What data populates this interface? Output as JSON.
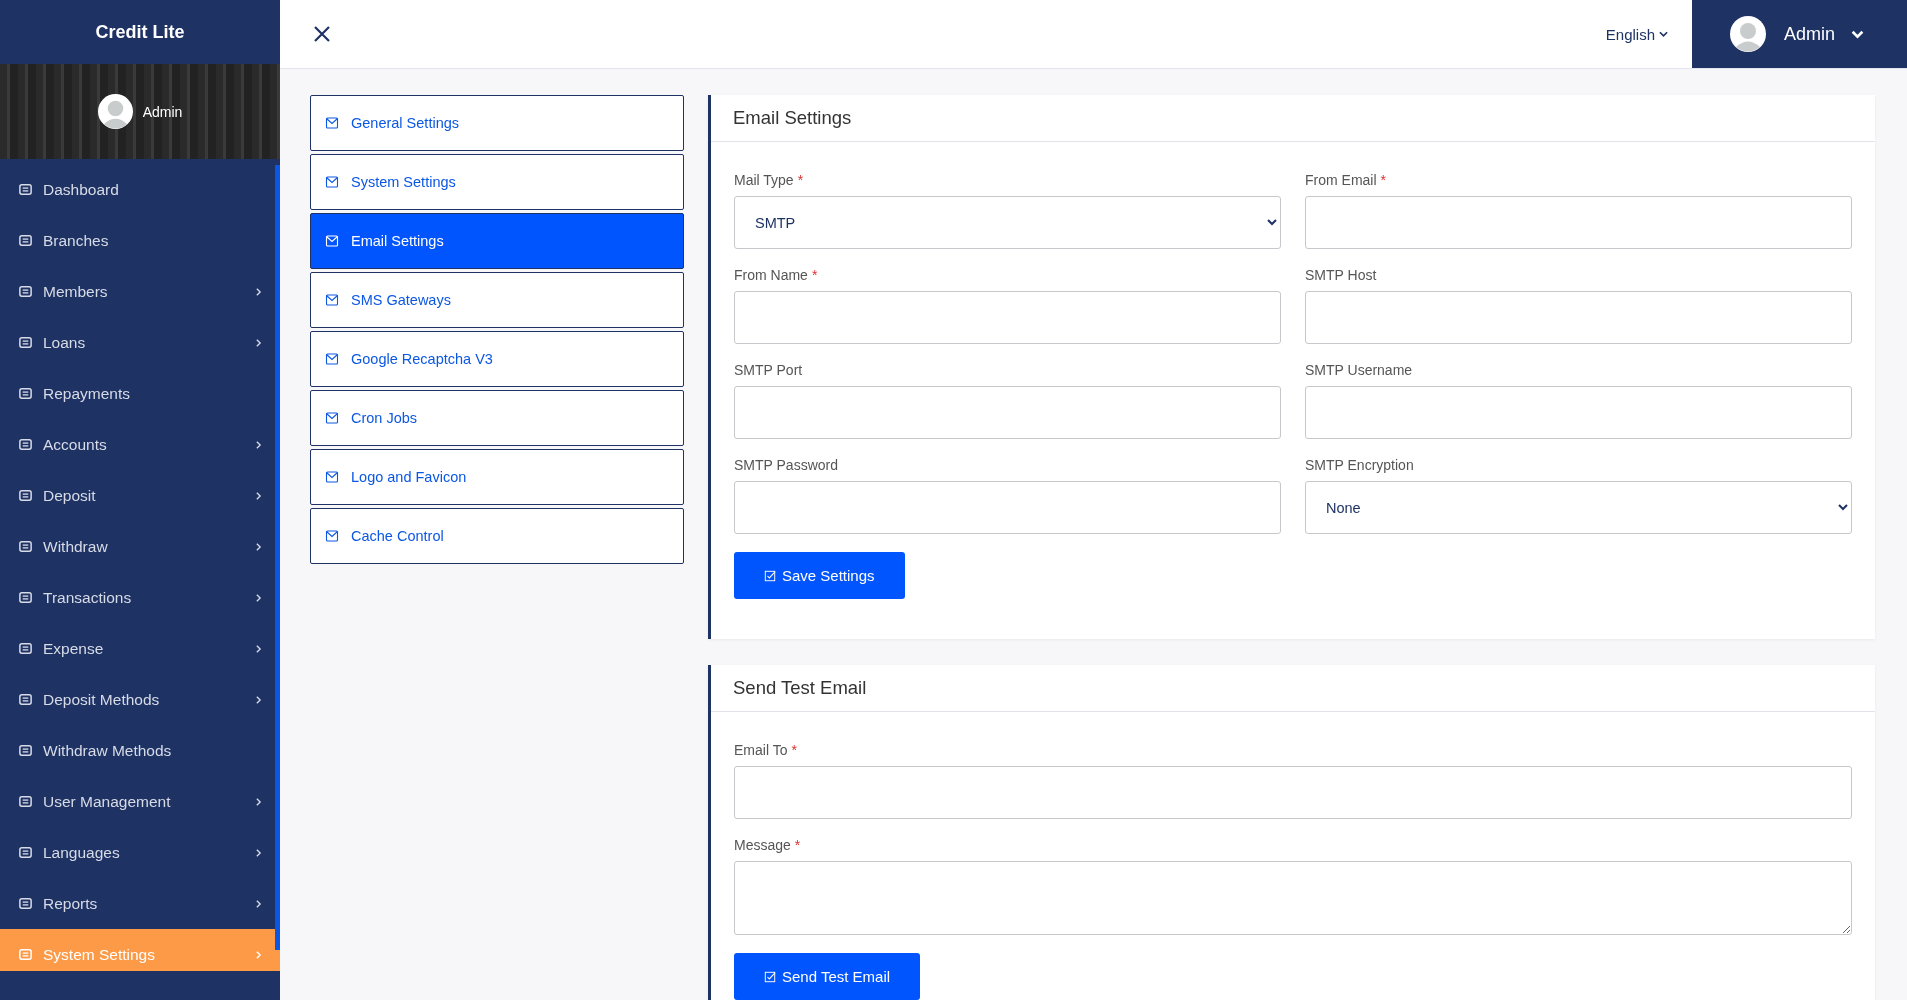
{
  "sidebar": {
    "brand": "Credit Lite",
    "user": "Admin",
    "items": [
      {
        "label": "Dashboard",
        "has_submenu": false,
        "selected": false
      },
      {
        "label": "Branches",
        "has_submenu": false,
        "selected": false
      },
      {
        "label": "Members",
        "has_submenu": true,
        "selected": false
      },
      {
        "label": "Loans",
        "has_submenu": true,
        "selected": false
      },
      {
        "label": "Repayments",
        "has_submenu": false,
        "selected": false
      },
      {
        "label": "Accounts",
        "has_submenu": true,
        "selected": false
      },
      {
        "label": "Deposit",
        "has_submenu": true,
        "selected": false
      },
      {
        "label": "Withdraw",
        "has_submenu": true,
        "selected": false
      },
      {
        "label": "Transactions",
        "has_submenu": true,
        "selected": false
      },
      {
        "label": "Expense",
        "has_submenu": true,
        "selected": false
      },
      {
        "label": "Deposit Methods",
        "has_submenu": true,
        "selected": false
      },
      {
        "label": "Withdraw Methods",
        "has_submenu": false,
        "selected": false
      },
      {
        "label": "User Management",
        "has_submenu": true,
        "selected": false
      },
      {
        "label": "Languages",
        "has_submenu": true,
        "selected": false
      },
      {
        "label": "Reports",
        "has_submenu": true,
        "selected": false
      },
      {
        "label": "System Settings",
        "has_submenu": true,
        "selected": true
      }
    ]
  },
  "topbar": {
    "language": "English",
    "user": "Admin"
  },
  "settings_menu": [
    {
      "label": "General Settings",
      "selected": false
    },
    {
      "label": "System Settings",
      "selected": false
    },
    {
      "label": "Email Settings",
      "selected": true
    },
    {
      "label": "SMS Gateways",
      "selected": false
    },
    {
      "label": "Google Recaptcha V3",
      "selected": false
    },
    {
      "label": "Cron Jobs",
      "selected": false
    },
    {
      "label": "Logo and Favicon",
      "selected": false
    },
    {
      "label": "Cache Control",
      "selected": false
    }
  ],
  "email_settings": {
    "title": "Email Settings",
    "fields": [
      {
        "label": "Mail Type",
        "required_mark": "*",
        "kind": "select",
        "value": "SMTP"
      },
      {
        "label": "From Email",
        "required_mark": "*",
        "kind": "input"
      },
      {
        "label": "From Name",
        "required_mark": "*",
        "kind": "input"
      },
      {
        "label": "SMTP Host",
        "kind": "input"
      },
      {
        "label": "SMTP Port",
        "kind": "input"
      },
      {
        "label": "SMTP Username",
        "kind": "input"
      },
      {
        "label": "SMTP Password",
        "kind": "input"
      },
      {
        "label": "SMTP Encryption",
        "kind": "select",
        "value": "None"
      }
    ],
    "button": "Save Settings"
  },
  "send_test_email": {
    "title": "Send Test Email",
    "fields": [
      {
        "label": "Email To",
        "required_mark": "*",
        "kind": "input"
      },
      {
        "label": "Message",
        "required_mark": "*",
        "kind": "textarea"
      }
    ],
    "button": "Send Test Email"
  }
}
